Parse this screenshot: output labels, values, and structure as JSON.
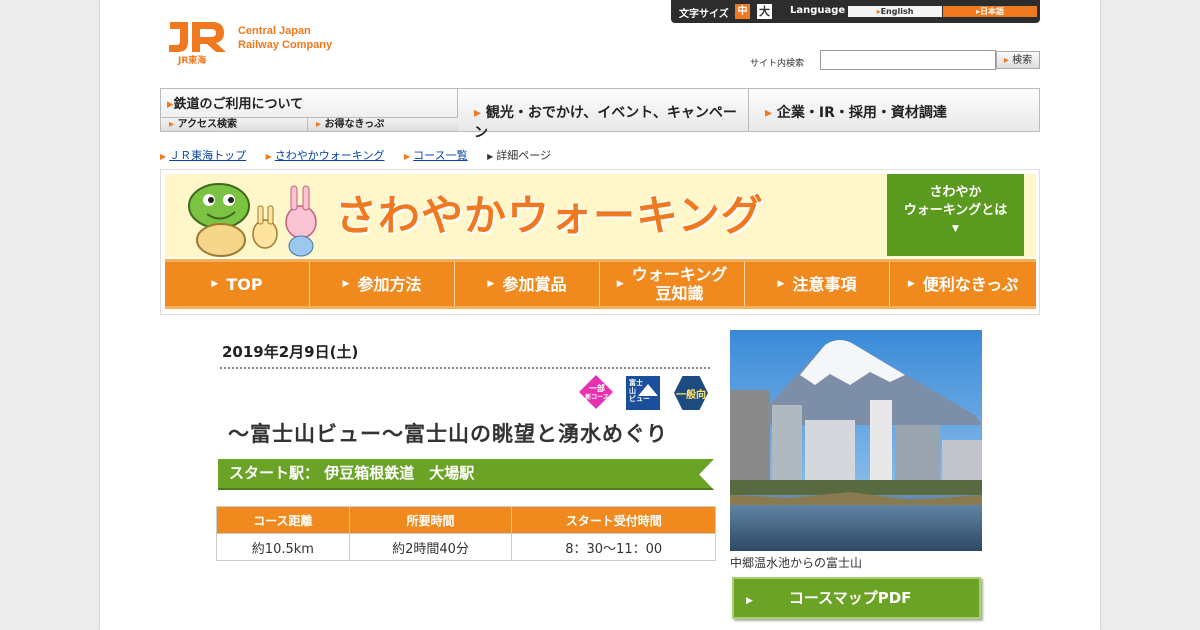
{
  "header": {
    "logo_mark": "JR",
    "logo_sub": "JR東海",
    "company_line1": "Central Japan",
    "company_line2": "Railway Company",
    "font_size_label": "文字サイズ",
    "font_size_mid": "中",
    "font_size_large": "大",
    "language_label": "Language",
    "lang_english": "English",
    "lang_japanese": "日本語",
    "search_label": "サイト内検索",
    "search_value": "",
    "search_button": "検索"
  },
  "global_nav": {
    "railway": "鉄道のご利用について",
    "access": "アクセス検索",
    "tickets": "お得なきっぷ",
    "tourism": "観光・おでかけ、イベント、キャンペーン",
    "corporate": "企業・IR・採用・資材調達"
  },
  "breadcrumb": [
    "ＪＲ東海トップ",
    "さわやかウォーキング",
    "コース一覧",
    "詳細ページ"
  ],
  "banner": {
    "title": "さわやかウォーキング",
    "about_line1": "さわやか",
    "about_line2": "ウォーキングとは",
    "tabs": [
      "TOP",
      "参加方法",
      "参加賞品",
      "ウォーキング",
      "豆知識",
      "注意事項",
      "便利なきっぷ"
    ]
  },
  "event": {
    "date": "2019年2月9日(土)",
    "badge_new_course_1": "一部",
    "badge_new_course_2": "新コース",
    "badge_fuji_1": "富士",
    "badge_fuji_2": "山",
    "badge_fuji_3": "ビュー",
    "badge_general": "一般向",
    "course_title": "～富士山ビュー～富士山の眺望と湧水めぐり",
    "start_station": "スタート駅： 伊豆箱根鉄道　大場駅",
    "table_headers": [
      "コース距離",
      "所要時間",
      "スタート受付時間"
    ],
    "table_values": [
      "約10.5km",
      "約2時間40分",
      "8：30～11：00"
    ],
    "photo_caption": "中郷温水池からの富士山",
    "pdf_button": "コースマップPDF"
  },
  "colors": {
    "accent_orange": "#f0781e",
    "green": "#6ba326"
  }
}
